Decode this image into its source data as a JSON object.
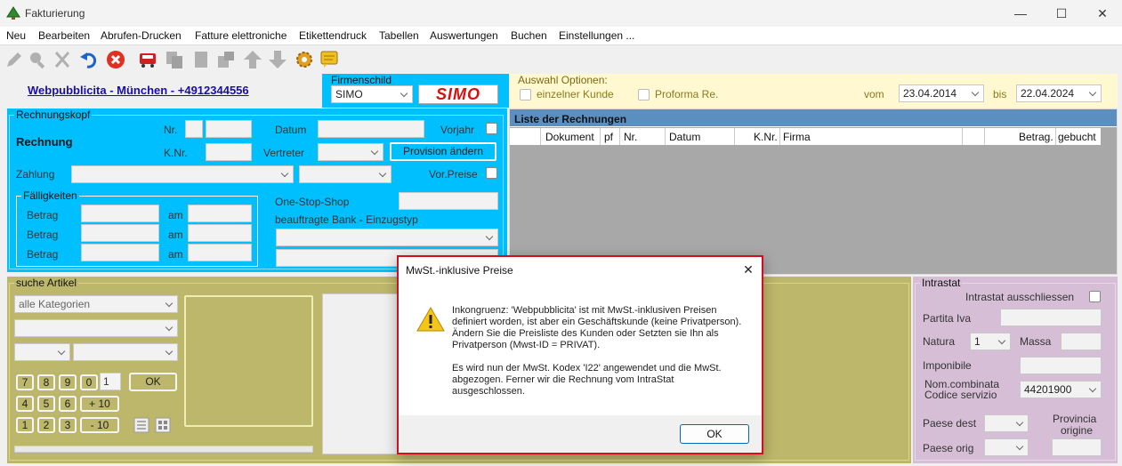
{
  "window": {
    "title": "Fakturierung",
    "minimize": "—",
    "maximize": "☐",
    "close": "✕"
  },
  "menu": [
    "Neu",
    "Bearbeiten",
    "Abrufen-Drucken",
    "Fatture elettroniche",
    "Etikettendruck",
    "Tabellen",
    "Auswertungen",
    "Buchen",
    "Einstellungen ..."
  ],
  "header": {
    "company_link": "Webpubblicita - München - +4912344556"
  },
  "firmenschild": {
    "legend": "Firmenschild",
    "selected": "SIMO",
    "logo_text": "SIMO"
  },
  "auswahl": {
    "legend": "Auswahl Optionen:",
    "einzelner_kunde": "einzelner Kunde",
    "proforma": "Proforma Re.",
    "vom_label": "vom",
    "vom_value": "23.04.2014",
    "bis_label": "bis",
    "bis_value": "22.04.2024"
  },
  "rechnungskopf": {
    "legend": "Rechnungskopf",
    "title": "Rechnung",
    "nr_label": "Nr.",
    "knr_label": "K.Nr.",
    "datum_label": "Datum",
    "vorjahr_label": "Vorjahr",
    "vertreter_label": "Vertreter",
    "provision_button": "Provision ändern",
    "zahlung_label": "Zahlung",
    "vorpreise_label": "Vor.Preise",
    "faelligkeiten_legend": "Fälligkeiten",
    "betrag_label": "Betrag",
    "am_label": "am",
    "oss_label": "One-Stop-Shop",
    "bank_label": "beauftragte Bank - Einzugstyp"
  },
  "rechnungen_list": {
    "title": "Liste der Rechnungen",
    "columns": [
      "Dokument",
      "pf",
      "Nr.",
      "Datum",
      "K.Nr.",
      "Firma",
      "",
      "Betrag.",
      "gebucht"
    ]
  },
  "artikel": {
    "legend": "suche Artikel",
    "kategorie": "alle Kategorien",
    "keys_row1": [
      "7",
      "8",
      "9",
      "0"
    ],
    "qty": "1",
    "ok": "OK",
    "keys_row2": [
      "4",
      "5",
      "6"
    ],
    "plus10": "+ 10",
    "keys_row3": [
      "1",
      "2",
      "3"
    ],
    "minus10": "- 10"
  },
  "intrastat": {
    "legend": "Intrastat",
    "ausschliessen": "Intrastat ausschliessen",
    "partita_iva": "Partita Iva",
    "natura": "Natura",
    "natura_value": "1",
    "massa": "Massa",
    "imponibile": "Imponibile",
    "nom_combinata": "Nom.combinata",
    "codice_servizio": "Codice servizio",
    "codice_value": "44201900",
    "paese_dest": "Paese dest",
    "provincia": "Provincia",
    "origine": "origine",
    "paese_orig": "Paese orig"
  },
  "dialog": {
    "title": "MwSt.-inklusive Preise",
    "close": "✕",
    "message1": "Inkongruenz: 'Webpubblicita' ist mit MwSt.-inklusiven Preisen definiert worden, ist aber ein Geschäftskunde (keine Privatperson). Ändern Sie die Preisliste des Kunden oder Setzten sie Ihn als Privatperson (Mwst-ID = PRIVAT).",
    "message2": "Es wird nun der MwSt. Kodex 'I22' angewendet und die MwSt. abgezogen. Ferner wir die Rechnung vom IntraStat ausgeschlossen.",
    "ok": "OK"
  },
  "colors": {
    "cyan": "#00bfff",
    "olive": "#bdb76b",
    "mauve": "#d6bed6",
    "dialog_border": "#d01020",
    "link": "#1a0dab"
  }
}
